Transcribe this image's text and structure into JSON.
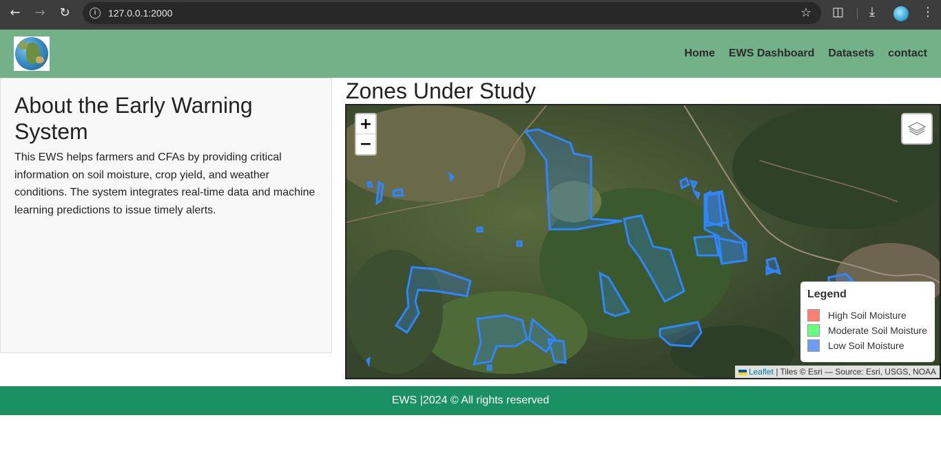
{
  "browser": {
    "url": "127.0.0.1:2000",
    "back_icon": "arrow-left-icon",
    "forward_icon": "arrow-right-icon",
    "reload_icon": "reload-icon"
  },
  "header": {
    "logo_icon": "globe-logo",
    "nav": [
      "Home",
      "EWS Dashboard",
      "Datasets",
      "contact"
    ]
  },
  "about": {
    "title": "About the Early Warning System",
    "body": "This EWS helps farmers and CFAs by providing critical information on soil moisture, crop yield, and weather conditions. The system integrates real-time data and machine learning predictions to issue timely alerts."
  },
  "map": {
    "title": "Zones Under Study",
    "zoom_in": "+",
    "zoom_out": "−",
    "legend": {
      "title": "Legend",
      "items": [
        {
          "label": "High Soil Moisture",
          "color": "#fa8072"
        },
        {
          "label": "Moderate Soil Moisture",
          "color": "#66ff80"
        },
        {
          "label": "Low Soil Moisture",
          "color": "#6e9cf7"
        }
      ]
    },
    "attribution": {
      "leaflet": "Leaflet",
      "rest": "| Tiles © Esri — Source: Esri, USGS, NOAA"
    },
    "zone_color": "#2f86ff"
  },
  "footer": {
    "text": "EWS |2024 © All rights reserved"
  }
}
